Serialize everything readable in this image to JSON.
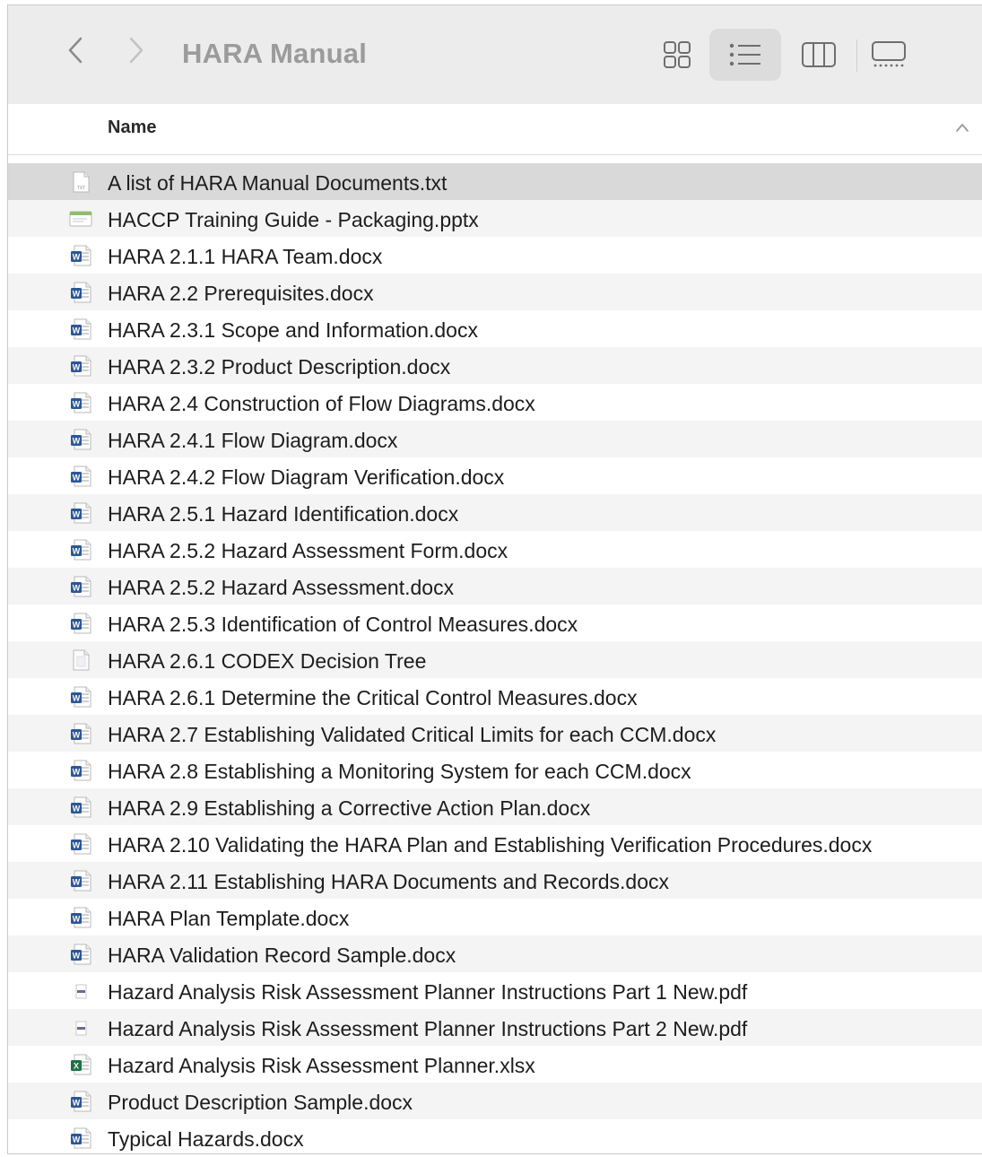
{
  "window": {
    "title": "HARA Manual"
  },
  "toolbar": {
    "back_icon": "chevron-left-icon",
    "forward_icon": "chevron-right-icon",
    "views": [
      "icon-view",
      "list-view",
      "column-view",
      "gallery-view"
    ],
    "active_view": "list-view"
  },
  "list_header": {
    "name_label": "Name",
    "sort_direction": "ascending"
  },
  "files": [
    {
      "name": "A list of HARA Manual Documents.txt",
      "icon": "text-file-icon"
    },
    {
      "name": "HACCP Training Guide - Packaging.pptx",
      "icon": "presentation-file-icon"
    },
    {
      "name": "HARA 2.1.1 HARA Team.docx",
      "icon": "word-doc-icon"
    },
    {
      "name": "HARA 2.2 Prerequisites.docx",
      "icon": "word-doc-icon"
    },
    {
      "name": "HARA 2.3.1 Scope and Information.docx",
      "icon": "word-doc-icon"
    },
    {
      "name": "HARA 2.3.2 Product Description.docx",
      "icon": "word-doc-icon"
    },
    {
      "name": "HARA 2.4 Construction of Flow Diagrams.docx",
      "icon": "word-doc-icon"
    },
    {
      "name": "HARA 2.4.1 Flow Diagram.docx",
      "icon": "word-doc-icon"
    },
    {
      "name": "HARA 2.4.2 Flow Diagram Verification.docx",
      "icon": "word-doc-icon"
    },
    {
      "name": "HARA 2.5.1 Hazard Identification.docx",
      "icon": "word-doc-icon"
    },
    {
      "name": "HARA 2.5.2 Hazard Assessment Form.docx",
      "icon": "word-doc-icon"
    },
    {
      "name": "HARA 2.5.2 Hazard Assessment.docx",
      "icon": "word-doc-icon"
    },
    {
      "name": "HARA 2.5.3 Identification of Control Measures.docx",
      "icon": "word-doc-icon"
    },
    {
      "name": "HARA 2.6.1 CODEX Decision Tree",
      "icon": "generic-file-icon"
    },
    {
      "name": "HARA 2.6.1 Determine the Critical Control Measures.docx",
      "icon": "word-doc-icon"
    },
    {
      "name": "HARA 2.7 Establishing Validated Critical Limits for each CCM.docx",
      "icon": "word-doc-icon"
    },
    {
      "name": "HARA 2.8 Establishing a Monitoring System for each CCM.docx",
      "icon": "word-doc-icon"
    },
    {
      "name": "HARA 2.9 Establishing a Corrective Action Plan.docx",
      "icon": "word-doc-icon"
    },
    {
      "name": "HARA 2.10 Validating the HARA Plan and Establishing Verification Procedures.docx",
      "icon": "word-doc-icon"
    },
    {
      "name": "HARA 2.11 Establishing HARA Documents and Records.docx",
      "icon": "word-doc-icon"
    },
    {
      "name": "HARA Plan Template.docx",
      "icon": "word-doc-icon"
    },
    {
      "name": "HARA Validation Record Sample.docx",
      "icon": "word-doc-icon"
    },
    {
      "name": "Hazard Analysis Risk Assessment Planner Instructions Part 1 New.pdf",
      "icon": "pdf-file-icon"
    },
    {
      "name": "Hazard Analysis Risk Assessment Planner Instructions Part 2 New.pdf",
      "icon": "pdf-file-icon"
    },
    {
      "name": "Hazard Analysis Risk Assessment Planner.xlsx",
      "icon": "excel-file-icon"
    },
    {
      "name": "Product Description Sample.docx",
      "icon": "word-doc-icon"
    },
    {
      "name": "Typical Hazards.docx",
      "icon": "word-doc-icon"
    }
  ],
  "selected_index": 0,
  "colors": {
    "toolbar_bg": "#ececec",
    "selected_row": "#d9d9d9",
    "alt_row": "#f4f4f4",
    "word_blue": "#2b5797",
    "excel_green": "#1e7145",
    "pdf_gray": "#6b6b8a"
  }
}
